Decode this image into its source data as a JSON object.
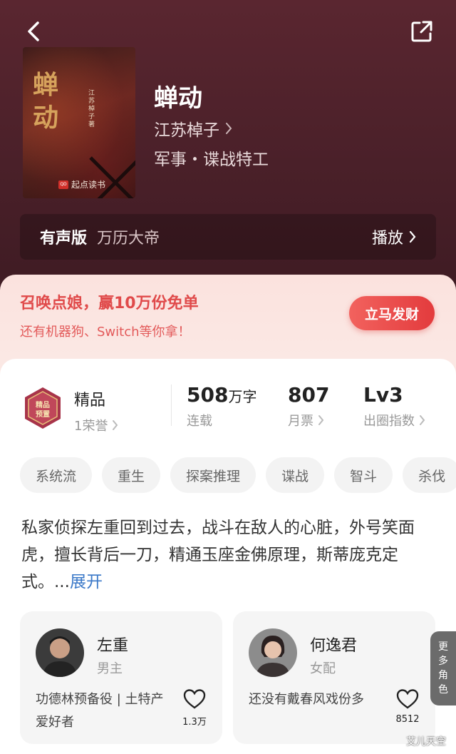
{
  "book": {
    "cover_title": "蝉动",
    "cover_author": "江苏棹子 著",
    "cover_publisher": "起点读书",
    "title": "蝉动",
    "author": "江苏棹子",
    "genre": "军事・谍战特工"
  },
  "audio": {
    "label": "有声版",
    "narrator": "万历大帝",
    "play_label": "播放"
  },
  "promo": {
    "headline": "召唤点娘，赢10万份免单",
    "subline": "还有机器狗、Switch等你拿！",
    "button": "立马发财"
  },
  "stats": {
    "quality": "精品",
    "honor": "1荣誉",
    "badge_text": "精品预置",
    "words_value": "508",
    "words_unit": "万字",
    "words_label": "连载",
    "monthly_value": "807",
    "monthly_label": "月票",
    "level_value": "Lv3",
    "level_label": "出圈指数"
  },
  "tags": [
    "系统流",
    "重生",
    "探案推理",
    "谍战",
    "智斗",
    "杀伐"
  ],
  "description": {
    "text": "私家侦探左重回到过去，战斗在敌人的心脏，外号笑面虎，擅长背后一刀，精通玉座金佛原理，斯蒂庞克定式。...",
    "more": "展开"
  },
  "characters": [
    {
      "name": "左重",
      "role": "男主",
      "bio": "功德林预备役 | 土特产爱好者",
      "likes": "1.3万"
    },
    {
      "name": "何逸君",
      "role": "女配",
      "bio": "还没有戴春风戏份多",
      "likes": "8512"
    }
  ],
  "more_roles": "更多角色",
  "watermark": "艾儿天空",
  "colors": {
    "hero": "#4a2029",
    "accent": "#e33b3d",
    "link": "#3a78c8"
  }
}
